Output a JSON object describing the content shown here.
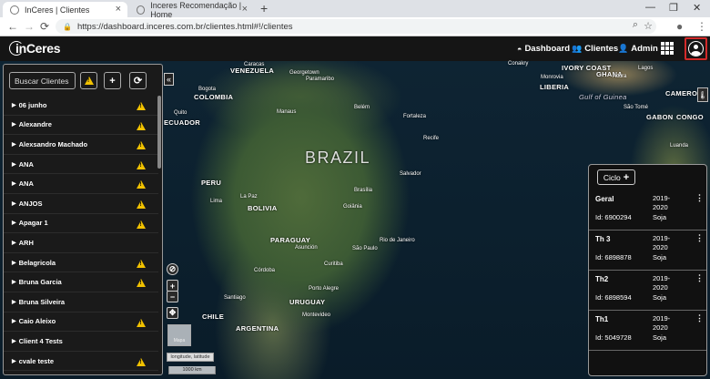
{
  "browser": {
    "tabs": [
      {
        "title": "InCeres | Clientes"
      },
      {
        "title": "Inceres Recomendação | Home"
      }
    ],
    "url": "https://dashboard.inceres.com.br/clientes.html#!/clientes"
  },
  "app": {
    "logo": "inCeres",
    "nav": [
      {
        "label": "Dashboard",
        "icon": "dashboard-icon"
      },
      {
        "label": "Clientes",
        "icon": "users-icon"
      },
      {
        "label": "Admin",
        "icon": "admin-icon"
      }
    ]
  },
  "sidebar": {
    "search_placeholder": "Buscar Clientes",
    "add_symbol": "+",
    "refresh_symbol": "⟳",
    "clients": [
      {
        "name": "06 junho",
        "warning": true
      },
      {
        "name": "Alexandre",
        "warning": true
      },
      {
        "name": "Alexsandro Machado",
        "warning": true
      },
      {
        "name": "ANA",
        "warning": true
      },
      {
        "name": "ANA",
        "warning": true
      },
      {
        "name": "ANJOS",
        "warning": true
      },
      {
        "name": "Apagar 1",
        "warning": true
      },
      {
        "name": "ARH",
        "warning": false
      },
      {
        "name": "Belagricola",
        "warning": true
      },
      {
        "name": "Bruna Garcia",
        "warning": true
      },
      {
        "name": "Bruna Silveira",
        "warning": false
      },
      {
        "name": "Caio Aleixo",
        "warning": true
      },
      {
        "name": "Client 4 Tests",
        "warning": false
      },
      {
        "name": "cvale teste",
        "warning": true
      }
    ]
  },
  "map": {
    "labels": {
      "brazil": "BRAZIL",
      "venezuela": "VENEZUELA",
      "colombia": "COLOMBIA",
      "ecuador": "ECUADOR",
      "peru": "PERU",
      "bolivia": "BOLIVIA",
      "paraguay": "PARAGUAY",
      "chile": "CHILE",
      "argentina": "ARGENTINA",
      "uruguay": "URUGUAY",
      "gulf_of_guinea": "Gulf of Guinea",
      "ivory_coast": "IVORY COAST",
      "ghana": "GHANA",
      "liberia": "LIBERIA",
      "gabon": "GABON",
      "cameroon": "CAMEROON",
      "congo": "CONGO"
    },
    "cities": [
      "Caracas",
      "Georgetown",
      "Paramaribo",
      "Bogota",
      "Quito",
      "Manaus",
      "Belém",
      "Fortaleza",
      "Recife",
      "Salvador",
      "Lima",
      "La Paz",
      "Brasília",
      "Goiânia",
      "Rio de Janeiro",
      "São Paulo",
      "Curitiba",
      "Asunción",
      "Córdoba",
      "Santiago",
      "Montevideo",
      "Porto Alegre",
      "Monrovia",
      "Accra",
      "Lagos",
      "São Tomé",
      "Luanda",
      "Conakry"
    ],
    "collapse_symbol": "«",
    "zoom_in": "+",
    "zoom_out": "−",
    "basemap_label": "Mapa",
    "coords_label": "longitude, latitude",
    "scale_label": "1000 km"
  },
  "ciclos": {
    "button_label": "Ciclo",
    "items": [
      {
        "name": "Geral",
        "year": "2019-2020",
        "id": "Id: 6900294",
        "crop": "Soja"
      },
      {
        "name": "Th 3",
        "year": "2019-2020",
        "id": "Id: 6898878",
        "crop": "Soja"
      },
      {
        "name": "Th2",
        "year": "2019-2020",
        "id": "Id: 6898594",
        "crop": "Soja"
      },
      {
        "name": "Th1",
        "year": "2019-2020",
        "id": "Id: 5049728",
        "crop": "Soja"
      }
    ]
  },
  "colors": {
    "accent_warning": "#f2c200",
    "user_button_border": "#d12a2a",
    "panel_bg": "#1a1a1a"
  }
}
